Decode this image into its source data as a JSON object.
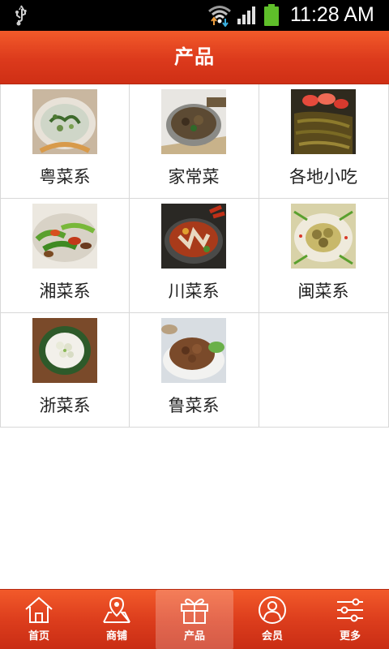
{
  "status_bar": {
    "time": "11:28 AM",
    "icons": [
      "usb-icon",
      "wifi-icon",
      "signal-icon",
      "battery-icon"
    ]
  },
  "header": {
    "title": "产品"
  },
  "categories": [
    {
      "label": "粤菜系",
      "image": "cantonese-dish-photo"
    },
    {
      "label": "家常菜",
      "image": "home-style-dish-photo"
    },
    {
      "label": "各地小吃",
      "image": "local-snacks-photo"
    },
    {
      "label": "湘菜系",
      "image": "hunan-dish-photo"
    },
    {
      "label": "川菜系",
      "image": "sichuan-dish-photo"
    },
    {
      "label": "闽菜系",
      "image": "fujian-dish-photo"
    },
    {
      "label": "浙菜系",
      "image": "zhejiang-dish-photo"
    },
    {
      "label": "鲁菜系",
      "image": "shandong-dish-photo"
    }
  ],
  "bottom_nav": {
    "active_index": 2,
    "items": [
      {
        "label": "首页",
        "icon": "home-icon"
      },
      {
        "label": "商铺",
        "icon": "map-marker-icon"
      },
      {
        "label": "产品",
        "icon": "gift-icon"
      },
      {
        "label": "会员",
        "icon": "user-icon"
      },
      {
        "label": "更多",
        "icon": "sliders-icon"
      }
    ]
  },
  "colors": {
    "accent": "#e2421f",
    "status_bar": "#000000",
    "grid_line": "#d8d8d8",
    "label_text": "#222222"
  }
}
